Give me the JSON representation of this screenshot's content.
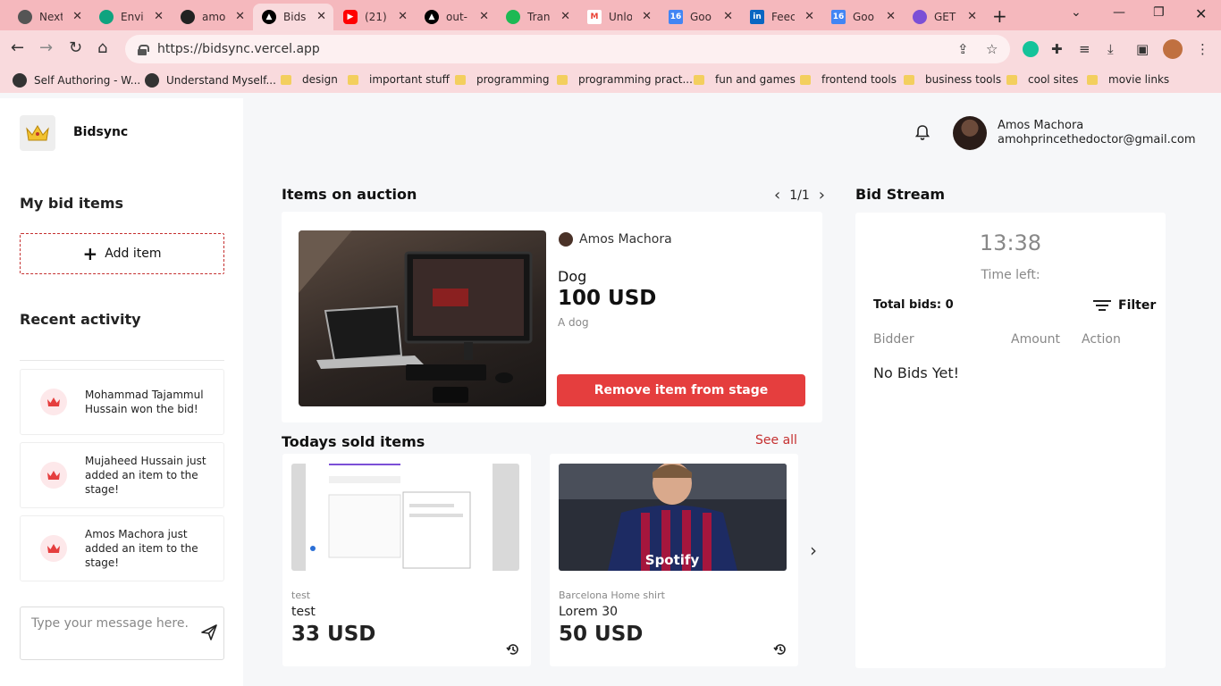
{
  "browser": {
    "tabs": [
      {
        "label": "Next",
        "icon": "circle-icon",
        "color": "#555555"
      },
      {
        "label": "Envi",
        "icon": "openai-icon",
        "color": "#10a37f"
      },
      {
        "label": "amo",
        "icon": "github-icon",
        "color": "#222222"
      },
      {
        "label": "Bids",
        "icon": "vercel-icon",
        "color": "#000000",
        "active": true
      },
      {
        "label": "(21)",
        "icon": "youtube-icon",
        "color": "#ff0000"
      },
      {
        "label": "out-",
        "icon": "vercel-icon",
        "color": "#000000"
      },
      {
        "label": "Tran",
        "icon": "spotify-icon",
        "color": "#1db954"
      },
      {
        "label": "Unlo",
        "icon": "gmail-icon",
        "color": "#ea4335"
      },
      {
        "label": "Goo",
        "icon": "calendar-icon",
        "color": "#4285f4"
      },
      {
        "label": "Feec",
        "icon": "linkedin-icon",
        "color": "#0a66c2"
      },
      {
        "label": "Goo",
        "icon": "calendar-icon",
        "color": "#4285f4"
      },
      {
        "label": "GET",
        "icon": "app-icon",
        "color": "#7b4fd6"
      }
    ],
    "url": "https://bidsync.vercel.app",
    "bookmarks": [
      {
        "label": "Self Authoring - W...",
        "type": "site"
      },
      {
        "label": "Understand Myself...",
        "type": "site"
      },
      {
        "label": "design",
        "type": "folder"
      },
      {
        "label": "important stuff",
        "type": "folder"
      },
      {
        "label": "programming",
        "type": "folder"
      },
      {
        "label": "programming pract...",
        "type": "folder"
      },
      {
        "label": "fun and games",
        "type": "folder"
      },
      {
        "label": "frontend tools",
        "type": "folder"
      },
      {
        "label": "business tools",
        "type": "folder"
      },
      {
        "label": "cool sites",
        "type": "folder"
      },
      {
        "label": "movie links",
        "type": "folder"
      }
    ]
  },
  "sidebar": {
    "brand": "Bidsync",
    "my_bid_items": "My bid items",
    "add_item": "Add item",
    "recent_activity": "Recent activity",
    "activities": [
      {
        "text": "Mohammad Tajammul Hussain won the bid!"
      },
      {
        "text": "Mujaheed Hussain just added an item to the stage!"
      },
      {
        "text": "Amos Machora just added an item to the stage!"
      }
    ],
    "message_placeholder": "Type your message here."
  },
  "header": {
    "user_name": "Amos Machora",
    "user_email": "amohprincethedoctor@gmail.com"
  },
  "auction": {
    "title": "Items on auction",
    "pager": "1/1",
    "seller": "Amos Machora",
    "item_name": "Dog",
    "price": "100 USD",
    "description": "A dog",
    "remove_button": "Remove item from stage"
  },
  "sold": {
    "title": "Todays sold items",
    "see_all": "See all",
    "items": [
      {
        "subtitle": "test",
        "name": "test",
        "price": "33 USD"
      },
      {
        "subtitle": "Barcelona Home shirt",
        "name": "Lorem 30",
        "price": "50 USD"
      }
    ]
  },
  "bid_stream": {
    "title": "Bid Stream",
    "timer": "13:38",
    "time_left": "Time left:",
    "total_bids": "Total bids: 0",
    "filter": "Filter",
    "columns": [
      "Bidder",
      "Amount",
      "Action"
    ],
    "empty": "No Bids Yet!"
  },
  "colors": {
    "accent": "#e53e3e",
    "chrome": "#f5b8bd"
  }
}
